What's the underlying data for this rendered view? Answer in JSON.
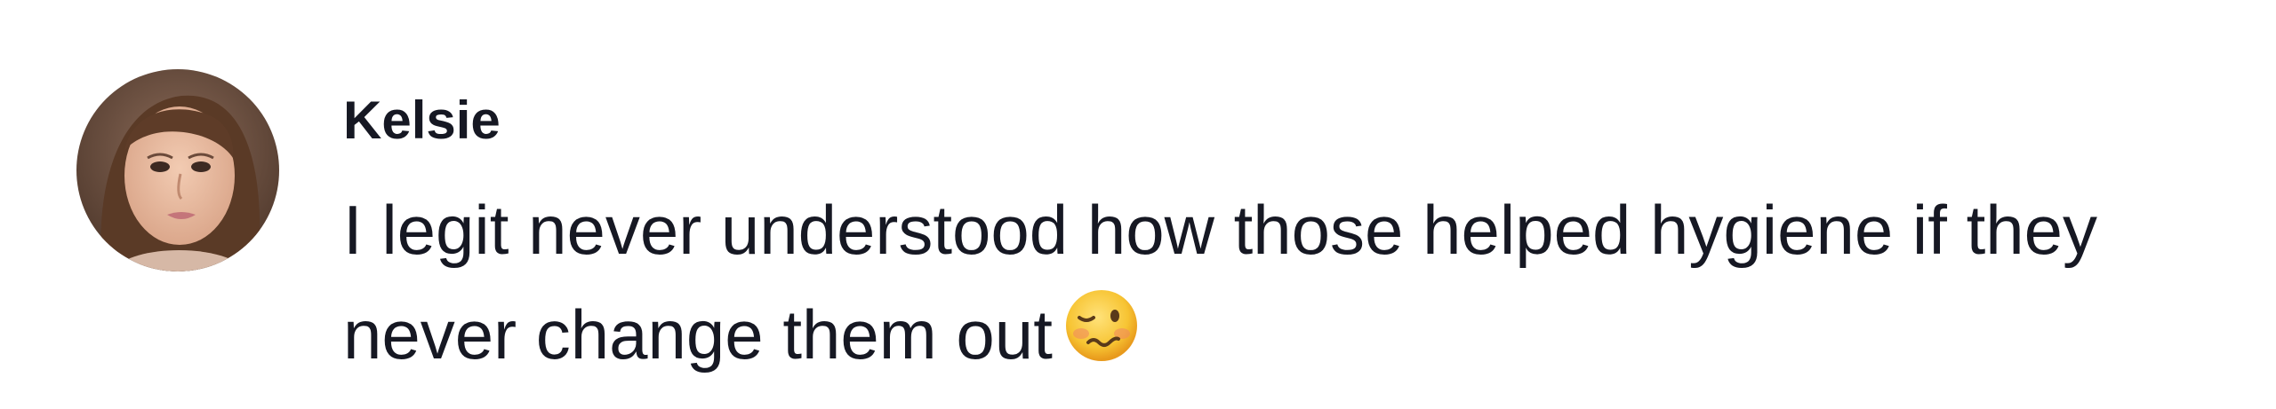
{
  "comment": {
    "username": "Kelsie",
    "text": "I legit never understood how those helped hygiene if they never change them out",
    "emoji_icon": "woozy-face-icon",
    "avatar_icon": "user-avatar"
  },
  "colors": {
    "text": "#161823",
    "background": "#ffffff",
    "emoji_yellow": "#f7c433"
  }
}
